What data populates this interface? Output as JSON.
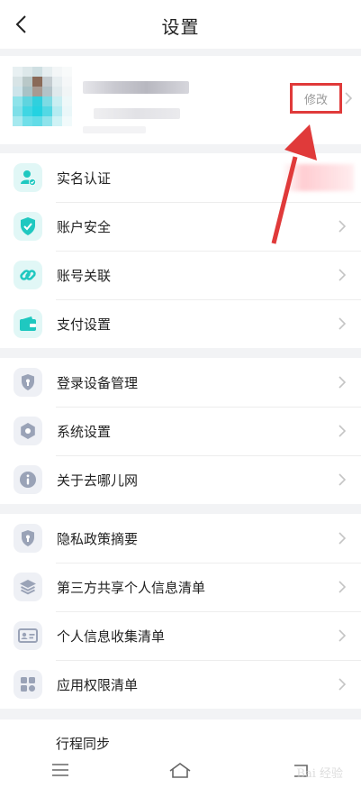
{
  "header": {
    "title": "设置"
  },
  "profile": {
    "edit_label": "修改"
  },
  "group1": [
    {
      "label": "实名认证",
      "icon": "user-verified-icon"
    },
    {
      "label": "账户安全",
      "icon": "shield-check-icon"
    },
    {
      "label": "账号关联",
      "icon": "link-icon"
    },
    {
      "label": "支付设置",
      "icon": "wallet-icon"
    }
  ],
  "group2": [
    {
      "label": "登录设备管理",
      "icon": "shield-icon"
    },
    {
      "label": "系统设置",
      "icon": "gear-icon"
    },
    {
      "label": "关于去哪儿网",
      "icon": "info-icon"
    }
  ],
  "group3": [
    {
      "label": "隐私政策摘要",
      "icon": "shield-icon"
    },
    {
      "label": "第三方共享个人信息清单",
      "icon": "layers-icon"
    },
    {
      "label": "个人信息收集清单",
      "icon": "id-card-icon"
    },
    {
      "label": "应用权限清单",
      "icon": "apps-grid-icon"
    }
  ],
  "group4": {
    "partial_label": "行程同步"
  },
  "colors": {
    "teal": "#1fc8c0",
    "gray_icon": "#9aa3b7",
    "annotation_red": "#e03a3a"
  },
  "watermark": "Bai 经验"
}
